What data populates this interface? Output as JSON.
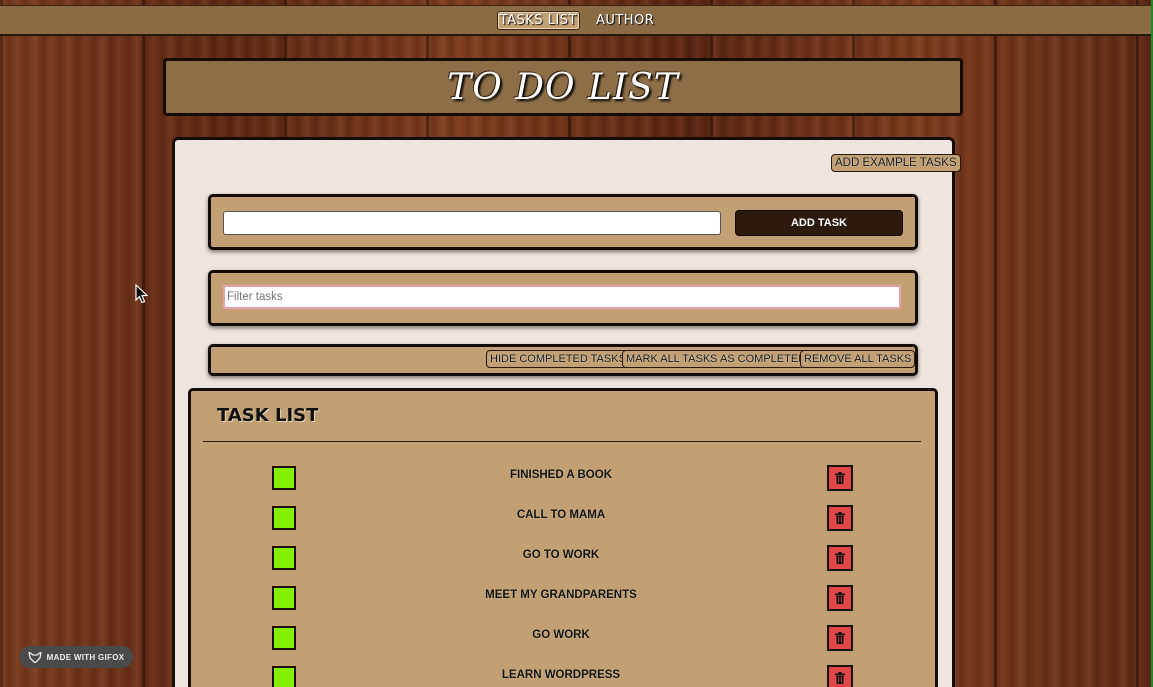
{
  "nav": {
    "items": [
      {
        "label": "TASKS LIST",
        "active": true
      },
      {
        "label": "AUTHOR",
        "active": false
      }
    ]
  },
  "header": {
    "title": "TO DO LIST"
  },
  "toolbar": {
    "add_example_label": "ADD EXAMPLE TASKS"
  },
  "new_task": {
    "value": "",
    "placeholder": "",
    "add_button_label": "ADD TASK"
  },
  "filter": {
    "value": "",
    "placeholder": "Filter tasks"
  },
  "actions": {
    "hide_completed_label": "HIDE COMPLETED TASKS",
    "mark_all_label": "MARK ALL TASKS AS COMPLETED",
    "remove_all_label": "REMOVE ALL TASKS"
  },
  "task_list": {
    "heading": "TASK LIST",
    "tasks": [
      {
        "label": "FINISHED A BOOK"
      },
      {
        "label": "CALL TO MAMA"
      },
      {
        "label": "GO TO WORK"
      },
      {
        "label": "MEET MY GRANDPARENTS"
      },
      {
        "label": "GO WORK"
      },
      {
        "label": "LEARN WORDPRESS"
      }
    ]
  },
  "badge": {
    "label": "MADE WITH GIFOX"
  },
  "colors": {
    "accent": "#c3a073",
    "checkbox": "#82f000",
    "delete": "#e04848",
    "add_button": "#2e1a0d"
  }
}
